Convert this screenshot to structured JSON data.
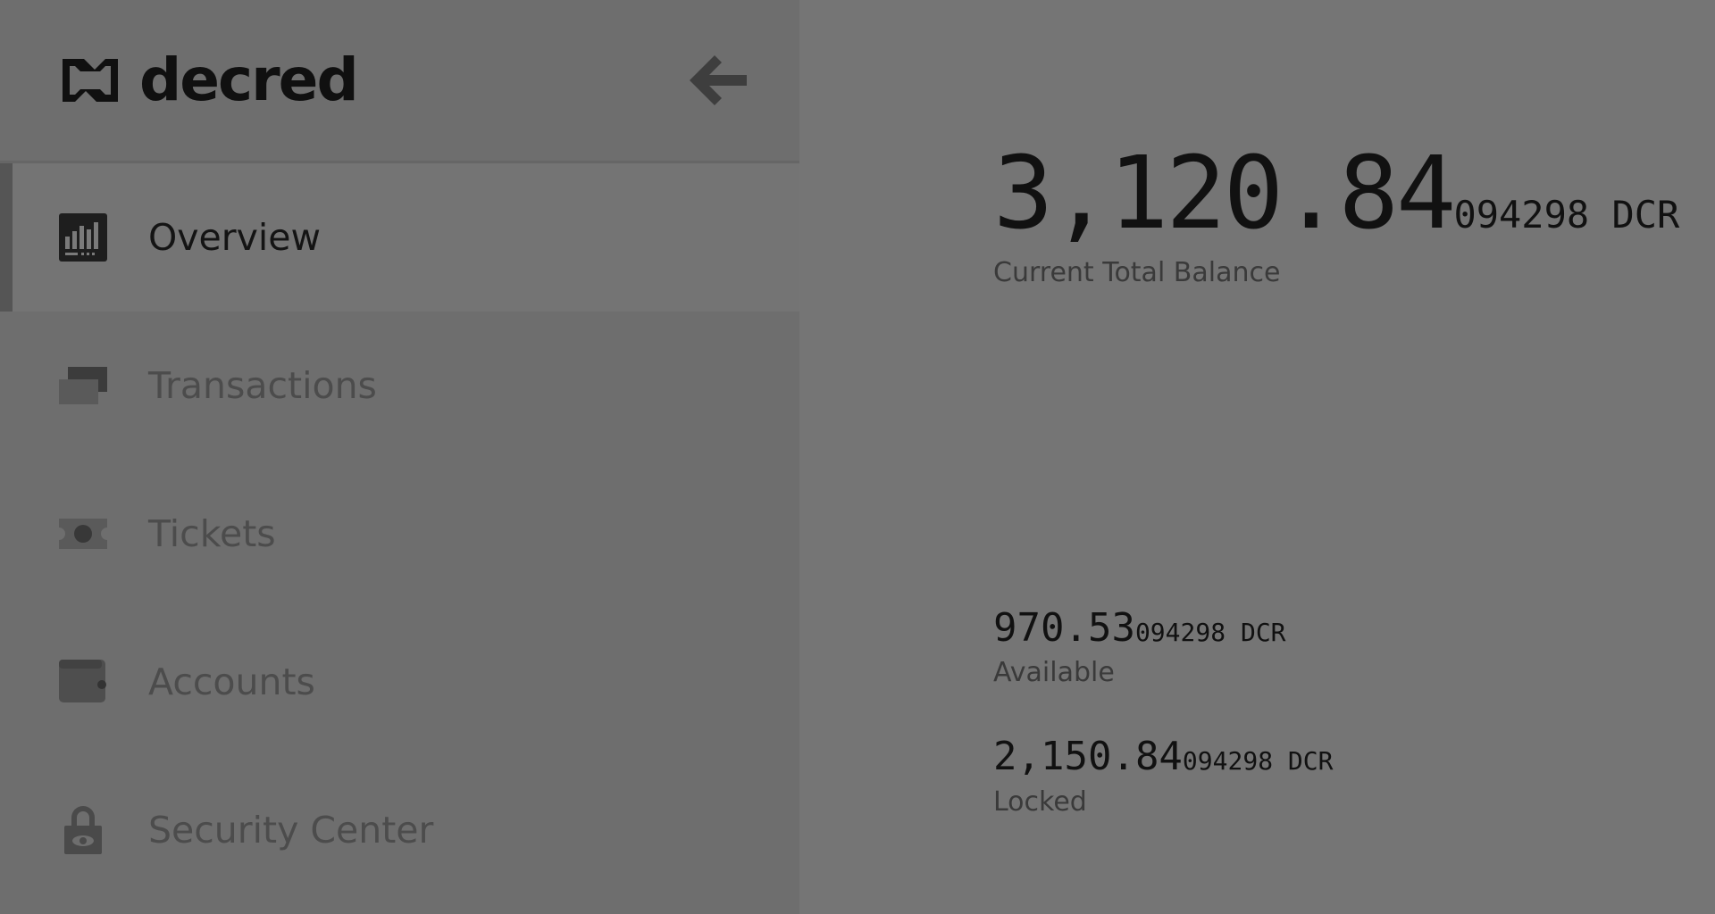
{
  "app": {
    "logo_text": "decred"
  },
  "sidebar": {
    "items": [
      {
        "label": "Overview",
        "icon": "overview-chart-icon",
        "active": true
      },
      {
        "label": "Transactions",
        "icon": "transactions-icon",
        "active": false
      },
      {
        "label": "Tickets",
        "icon": "ticket-icon",
        "active": false
      },
      {
        "label": "Accounts",
        "icon": "wallet-icon",
        "active": false
      },
      {
        "label": "Security Center",
        "icon": "lock-icon",
        "active": false
      }
    ]
  },
  "overview": {
    "total": {
      "major": "3,120.84",
      "minor": "094298 DCR",
      "label": "Current Total Balance"
    },
    "available": {
      "major": "970.53",
      "minor": "094298 DCR",
      "label": "Available"
    },
    "locked": {
      "major": "2,150.84",
      "minor": "094298 DCR",
      "label": "Locked"
    }
  },
  "colors": {
    "background": "#757575",
    "sidebar": "#6e6e6e",
    "active_item": "#747474",
    "text_dark": "#111111"
  }
}
